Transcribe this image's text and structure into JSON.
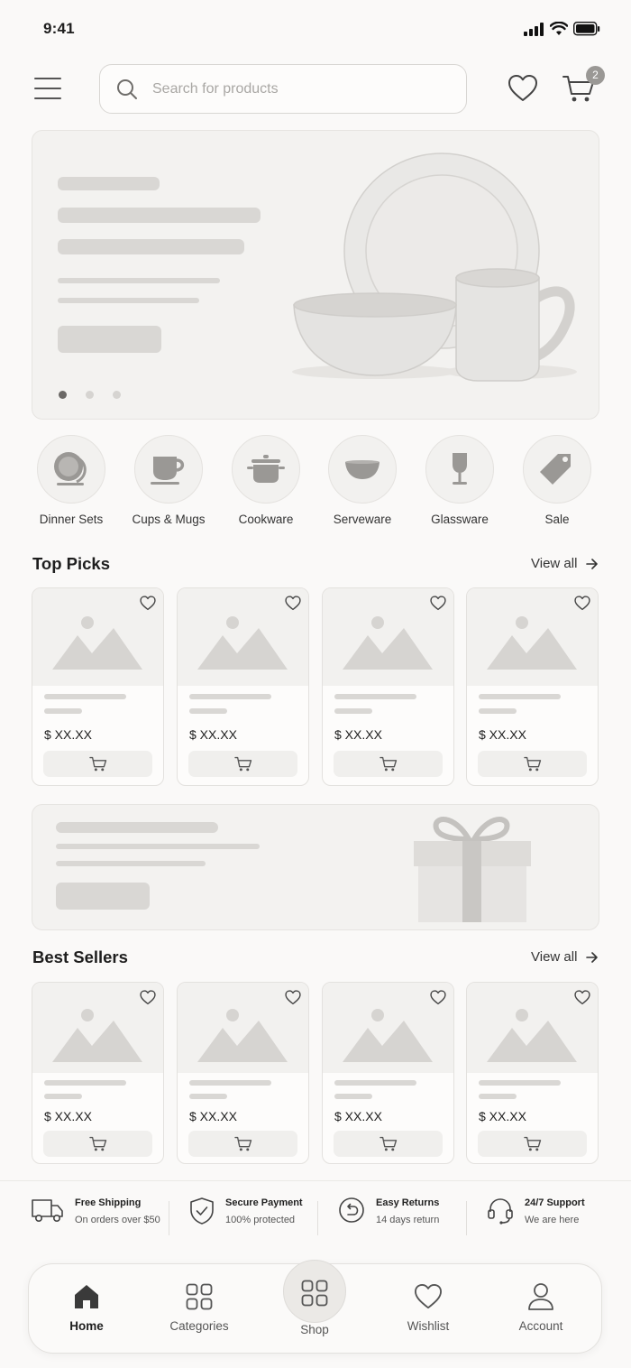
{
  "status_bar": {
    "time": "9:41"
  },
  "header": {
    "search_placeholder": "Search for products",
    "cart_badge": "2"
  },
  "hero": {
    "active_slide": 1,
    "slide_count": 3
  },
  "categories": [
    {
      "label": "Dinner Sets",
      "icon": "plate-icon"
    },
    {
      "label": "Cups & Mugs",
      "icon": "cup-icon"
    },
    {
      "label": "Cookware",
      "icon": "pot-icon"
    },
    {
      "label": "Serveware",
      "icon": "bowl-icon"
    },
    {
      "label": "Glassware",
      "icon": "wine-glass-icon"
    },
    {
      "label": "Sale",
      "icon": "tag-icon"
    }
  ],
  "top_picks": {
    "title": "Top Picks",
    "view_all": "View all",
    "products": [
      {
        "price": "$ XX.XX"
      },
      {
        "price": "$ XX.XX"
      },
      {
        "price": "$ XX.XX"
      },
      {
        "price": "$ XX.XX"
      }
    ]
  },
  "best_sellers": {
    "title": "Best Sellers",
    "view_all": "View all",
    "products": [
      {
        "price": "$ XX.XX"
      },
      {
        "price": "$ XX.XX"
      },
      {
        "price": "$ XX.XX"
      },
      {
        "price": "$ XX.XX"
      }
    ]
  },
  "features": [
    {
      "title": "Free Shipping",
      "subtitle": "On orders over $50",
      "icon": "truck-icon"
    },
    {
      "title": "Secure Payment",
      "subtitle": "100% protected",
      "icon": "shield-check-icon"
    },
    {
      "title": "Easy Returns",
      "subtitle": "14 days return",
      "icon": "return-icon"
    },
    {
      "title": "24/7 Support",
      "subtitle": "We are here",
      "icon": "headset-icon"
    }
  ],
  "tab_bar": {
    "active": "Home",
    "items": [
      {
        "label": "Home",
        "icon": "home-icon"
      },
      {
        "label": "Categories",
        "icon": "grid-icon"
      },
      {
        "label": "Shop",
        "icon": "shop-grid-icon"
      },
      {
        "label": "Wishlist",
        "icon": "heart-icon"
      },
      {
        "label": "Account",
        "icon": "user-icon"
      }
    ]
  },
  "colors": {
    "background": "#faf9f8",
    "placeholder": "#d9d7d4",
    "text": "#1e1e1e",
    "badge": "#9a9895"
  }
}
